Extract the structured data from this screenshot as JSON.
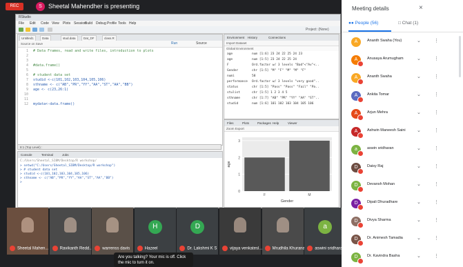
{
  "meeting": {
    "rec_label": "REC",
    "presenter_initial": "S",
    "presenting_text": "Sheetal Mahendher is presenting",
    "mic_toast": "Are you talking? Your mic is off. Click the mic to turn it on."
  },
  "rstudio": {
    "title": "RStudio",
    "menu": [
      "File",
      "Edit",
      "Code",
      "View",
      "Plots",
      "Session",
      "Build",
      "Debug",
      "Profile",
      "Tools",
      "Help"
    ],
    "project_label": "Project: (None)",
    "addins_label": "Addins",
    "editor_tabs": [
      "Untitled1",
      "Data",
      "stud.data",
      "Dat_DF",
      "class.R"
    ],
    "source_on_save": "Source on Save",
    "run_label": "Run",
    "source_label": "Source",
    "code_lines": [
      {
        "n": "1",
        "text": "# Data Frames, read and write files, introduction to plots",
        "comment": true
      },
      {
        "n": "2",
        "text": "",
        "comment": false
      },
      {
        "n": "3",
        "text": "",
        "comment": false
      },
      {
        "n": "4",
        "text": "#data.frame()",
        "comment": true
      },
      {
        "n": "5",
        "text": "",
        "comment": false
      },
      {
        "n": "6",
        "text": "# student data set",
        "comment": true
      },
      {
        "n": "7",
        "text": "studid <-c(101,102,103,104,105,106)",
        "comment": false
      },
      {
        "n": "8",
        "text": "sthname <- c(\"AB\",\"PR\",\"YY\",\"AA\",\"ST\",\"AA\",\"BB\")",
        "comment": false
      },
      {
        "n": "9",
        "text": "age <- c(23,26:1)",
        "comment": false
      },
      {
        "n": "10",
        "text": "",
        "comment": false
      },
      {
        "n": "11",
        "text": "",
        "comment": false
      },
      {
        "n": "12",
        "text": "mydata<-data.frame()",
        "comment": false
      }
    ],
    "editor_status": "8:1   (Top Level) :",
    "console_tabs": [
      "Console",
      "Terminal",
      "Jobs"
    ],
    "console_path": "C:/Users/Sheetal_SIBM/Desktop/R workshop/",
    "console_lines": [
      "> setwd(\"C:/Users/Sheetal_SIBM/Desktop/R workshop\")",
      "> # student data set",
      "> studid <-c(101,102,103,104,105,106)",
      "> sthname <- c(\"AB\",\"PR\",\"YY\",\"AA\",\"ST\",\"AA\",\"BB\")",
      ">"
    ],
    "env_tabs": [
      "Environment",
      "History",
      "Connections"
    ],
    "env_tools": "Import Dataset",
    "env_global": "Global Environment",
    "env_rows": [
      {
        "name": "age",
        "value": "num [1:6] 23 24 22 25 24 23"
      },
      {
        "name": "age",
        "value": "num [1:5] 23 24 22 25 24"
      },
      {
        "name": "F",
        "value": "Ord.factor w/ 3 levels \"Bad\"<\"Av\"<.."
      },
      {
        "name": "Gender",
        "value": "chr [1:5] \"M\" \"F\" \"M\" \"M\" \"F\""
      },
      {
        "name": "numi",
        "value": "58"
      },
      {
        "name": "performance",
        "value": "Ord.factor w/ 3 levels \"very good\".."
      },
      {
        "name": "status",
        "value": "chr [1:5] \"Pass\" \"Pass\" \"Fail\" \"Pa.."
      },
      {
        "name": "stulist",
        "value": "chr [1:5] 1 2 3 4 5"
      },
      {
        "name": "sthname",
        "value": "chr [1:7] \"AB\" \"PR\" \"YY\" \"AA\" \"ST\".."
      },
      {
        "name": "studid",
        "value": "num [1:6] 101 102 103 104 105 106"
      }
    ],
    "plot_tabs": [
      "Files",
      "Plots",
      "Packages",
      "Help",
      "Viewer"
    ],
    "plot_tools": "Zoom   Export",
    "chart_data": {
      "type": "bar",
      "categories": [
        "F",
        "M"
      ],
      "values": [
        2,
        3
      ],
      "xlabel": "Gender",
      "ylabel": "age",
      "ylim": [
        0,
        3.2
      ],
      "yticks": [
        0,
        1,
        2,
        3
      ],
      "bar_color": "#595959"
    }
  },
  "thumbnails": [
    {
      "name": "Sheetal Mahen...",
      "type": "video",
      "color": "#6b4f3f"
    },
    {
      "name": "Ravikanth Redd...",
      "type": "video",
      "color": "#4a4a4a"
    },
    {
      "name": "warrenss davis",
      "type": "video",
      "color": "#5a5048"
    },
    {
      "name": "Hazeel",
      "type": "avatar",
      "initial": "H",
      "color": "#34a853"
    },
    {
      "name": "Dr. Lakshmi K S",
      "type": "avatar",
      "initial": "D",
      "color": "#34a853"
    },
    {
      "name": "vijaya venkatesl...",
      "type": "video",
      "color": "#3a3a3a"
    },
    {
      "name": "Mrudhila Khurana",
      "type": "video",
      "color": "#4a4a4a"
    },
    {
      "name": "aswini sridharan",
      "type": "avatar",
      "initial": "a",
      "color": "#7cb342"
    }
  ],
  "panel": {
    "title": "Meeting details",
    "close_icon": "×",
    "people_tab": "People (56)",
    "chat_tab": "Chat (1)",
    "people": [
      {
        "name": "Ananth Swaha (You)",
        "initial": "A",
        "color": "#f9a825",
        "mic_off": false
      },
      {
        "name": "Anusaya Arumugham",
        "initial": "A",
        "color": "#f57c00",
        "mic_off": true
      },
      {
        "name": "Ananth Swaha",
        "initial": "A",
        "color": "#f9a825",
        "mic_off": true
      },
      {
        "name": "Ankita Tomar",
        "initial": "A",
        "color": "#5c6bc0",
        "mic_off": true
      },
      {
        "name": "Arjun Mehra",
        "initial": "A",
        "color": "#e64a19",
        "mic_off": true
      },
      {
        "name": "Ashwin Maneesh Saini",
        "initial": "A",
        "color": "#c62828",
        "mic_off": true
      },
      {
        "name": "aswin sridharan",
        "initial": "a",
        "color": "#7cb342",
        "mic_off": true
      },
      {
        "name": "Daisy Raj",
        "initial": "D",
        "color": "#6d4c41",
        "mic_off": true
      },
      {
        "name": "Devansh Mohan",
        "initial": "D",
        "color": "#7cb342",
        "mic_off": true
      },
      {
        "name": "Dipali Dhuradhare",
        "initial": "D",
        "color": "#7b1fa2",
        "mic_off": true
      },
      {
        "name": "Divya Sharma",
        "initial": "D",
        "color": "#8d6e63",
        "mic_off": true
      },
      {
        "name": "Dr. Animesh Tamadia",
        "initial": "D",
        "color": "#795548",
        "mic_off": true
      },
      {
        "name": "Dr. Kavindra Basha",
        "initial": "D",
        "color": "#7cb342",
        "mic_off": true
      }
    ]
  }
}
